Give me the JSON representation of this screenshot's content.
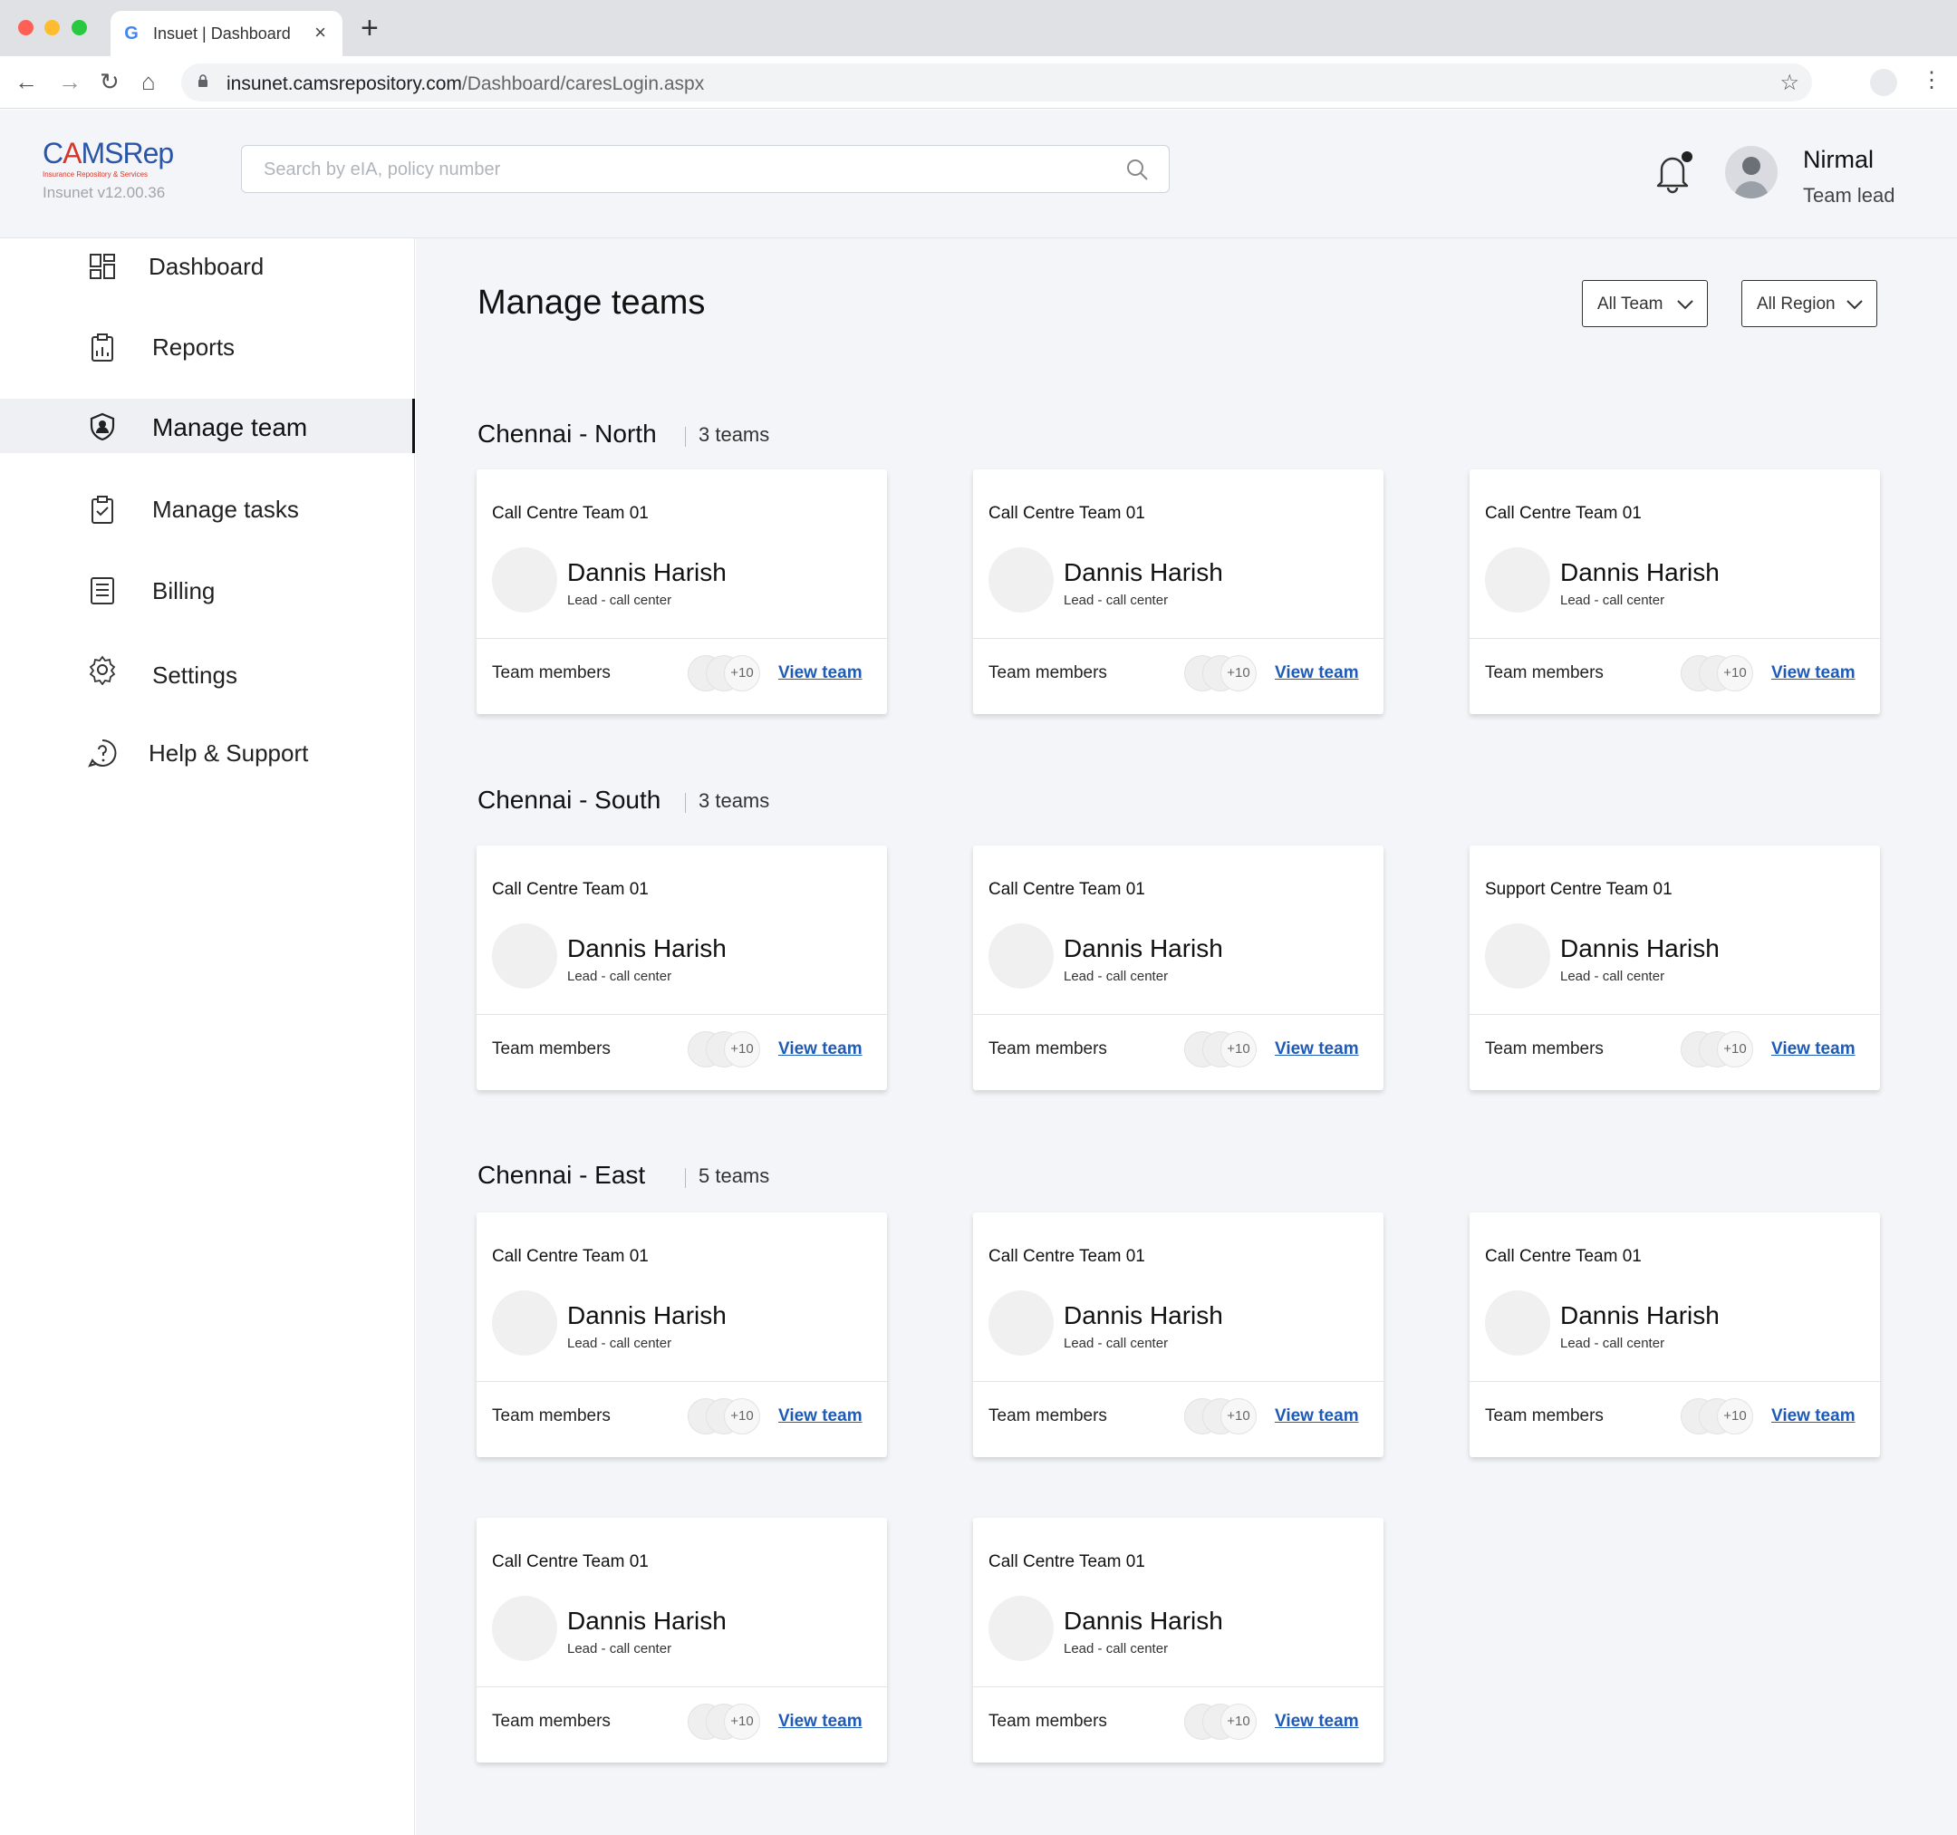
{
  "browser": {
    "tab_title": "Insuet | Dashboard",
    "url_host": "insunet.camsrepository.com",
    "url_path": "/Dashboard/caresLogin.aspx",
    "traffic_colors": [
      "#ff5f57",
      "#febc2e",
      "#28c840"
    ]
  },
  "header": {
    "logo_brand_prefix": "C",
    "logo_brand_a": "A",
    "logo_brand_suffix": "MSRep",
    "logo_tagline": "Insurance Repository & Services",
    "version": "Insunet v12.00.36",
    "search_placeholder": "Search by eIA, policy number",
    "user_name": "Nirmal",
    "user_role": "Team lead"
  },
  "sidebar": {
    "items": [
      {
        "label": "Dashboard",
        "icon": "dashboard-icon"
      },
      {
        "label": "Reports",
        "icon": "clipboard-icon"
      },
      {
        "label": "Manage team",
        "icon": "shield-user-icon",
        "active": true
      },
      {
        "label": "Manage tasks",
        "icon": "clipboard-check-icon"
      },
      {
        "label": "Billing",
        "icon": "receipt-icon"
      },
      {
        "label": "Settings",
        "icon": "gear-icon"
      },
      {
        "label": "Help & Support",
        "icon": "help-circle-icon"
      }
    ]
  },
  "main": {
    "title": "Manage teams",
    "filters": {
      "team": "All Team",
      "region": "All Region"
    },
    "card_labels": {
      "members": "Team members",
      "view": "View team",
      "more": "+10"
    },
    "regions": [
      {
        "name": "Chennai - North",
        "count": "3 teams",
        "teams": [
          {
            "team": "Call Centre Team 01",
            "lead": "Dannis Harish",
            "role": "Lead - call center"
          },
          {
            "team": "Call Centre Team 01",
            "lead": "Dannis Harish",
            "role": "Lead - call center"
          },
          {
            "team": "Call Centre Team 01",
            "lead": "Dannis Harish",
            "role": "Lead - call center"
          }
        ]
      },
      {
        "name": "Chennai - South",
        "count": "3 teams",
        "teams": [
          {
            "team": "Call Centre Team 01",
            "lead": "Dannis Harish",
            "role": "Lead - call center"
          },
          {
            "team": "Call Centre Team 01",
            "lead": "Dannis Harish",
            "role": "Lead - call center"
          },
          {
            "team": "Support Centre Team 01",
            "lead": "Dannis Harish",
            "role": "Lead - call center"
          }
        ]
      },
      {
        "name": "Chennai - East",
        "count": "5 teams",
        "teams": [
          {
            "team": "Call Centre Team 01",
            "lead": "Dannis Harish",
            "role": "Lead - call center"
          },
          {
            "team": "Call Centre Team 01",
            "lead": "Dannis Harish",
            "role": "Lead - call center"
          },
          {
            "team": "Call Centre Team 01",
            "lead": "Dannis Harish",
            "role": "Lead - call center"
          },
          {
            "team": "Call Centre Team 01",
            "lead": "Dannis Harish",
            "role": "Lead - call center"
          },
          {
            "team": "Call Centre Team 01",
            "lead": "Dannis Harish",
            "role": "Lead - call center"
          }
        ]
      }
    ]
  }
}
